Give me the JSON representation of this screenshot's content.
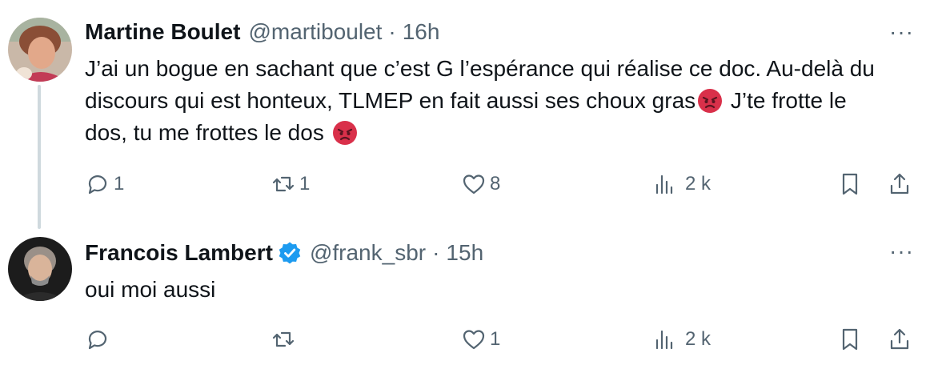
{
  "tweets": [
    {
      "name": "Martine Boulet",
      "handle": "@martiboulet",
      "sep": "·",
      "time": "16h",
      "text_part1": "J’ai un bogue en sachant que c’est G l’espérance qui réalise ce doc.  Au-delà du discours qui est honteux, TLMEP en fait aussi ses choux gras",
      "text_part2": " J’te frotte le dos, tu me frottes le dos ",
      "emoji": "angry-face",
      "more": "···",
      "replies": "1",
      "retweets": "1",
      "likes": "8",
      "views": "2 k",
      "verified": false
    },
    {
      "name": "Francois Lambert",
      "handle": "@frank_sbr",
      "sep": "·",
      "time": "15h",
      "text": "oui moi aussi",
      "more": "···",
      "replies": "",
      "retweets": "",
      "likes": "1",
      "views": "2 k",
      "verified": true
    }
  ],
  "colors": {
    "text": "#0f1419",
    "secondary": "#536471",
    "verified": "#1d9bf0",
    "thread": "#cfd9de",
    "angry": "#d9304a"
  }
}
